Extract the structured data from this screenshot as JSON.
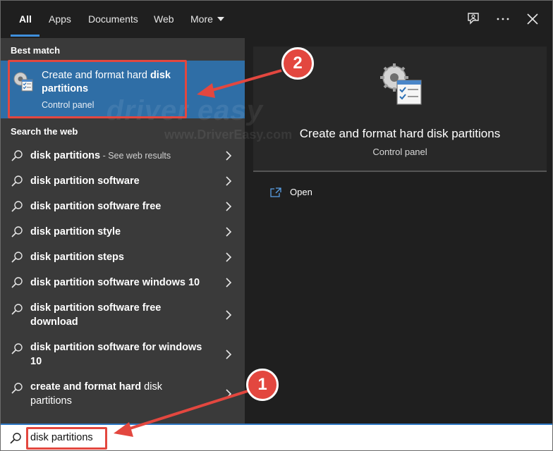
{
  "tabs": [
    {
      "label": "All",
      "active": true
    },
    {
      "label": "Apps"
    },
    {
      "label": "Documents"
    },
    {
      "label": "Web"
    },
    {
      "label": "More"
    }
  ],
  "topbar_icons": [
    "feedback-icon",
    "more-options-icon",
    "close-icon"
  ],
  "left": {
    "best_match_heading": "Best match",
    "best_match": {
      "title_plain": "Create and format hard ",
      "title_bold": "disk partitions",
      "subtitle": "Control panel"
    },
    "web_heading": "Search the web",
    "web_results": [
      {
        "bold": "disk partitions",
        "plain": " - ",
        "hint": "See web results"
      },
      {
        "bold": "disk partition software"
      },
      {
        "bold": "disk partition software free"
      },
      {
        "bold": "disk partition style"
      },
      {
        "bold": "disk partition steps"
      },
      {
        "bold": "disk partition software windows 10"
      },
      {
        "bold": "disk partition software free download"
      },
      {
        "bold": "disk partition software for windows 10"
      },
      {
        "bold": "create and format hard ",
        "tail": "disk partitions"
      }
    ]
  },
  "right": {
    "title": "Create and format hard disk partitions",
    "subtitle": "Control panel",
    "action_label": "Open"
  },
  "search": {
    "value": "disk partitions"
  },
  "annotations": {
    "badge_1": "1",
    "badge_2": "2",
    "color": "#e3473f"
  },
  "watermark": {
    "brand": "driver easy",
    "url": "www.DriverEasy.com"
  },
  "colors": {
    "accent": "#2f78c4",
    "selected_bg": "#2f6ea6",
    "left_bg": "#3a3a3a",
    "right_bg": "#1f1f1f"
  }
}
